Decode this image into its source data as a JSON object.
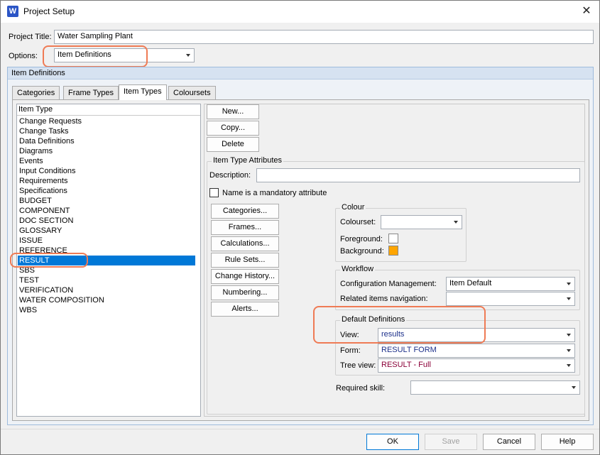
{
  "window": {
    "title": "Project Setup",
    "app_icon_letter": "W"
  },
  "project": {
    "title_label": "Project Title:",
    "title_value": "Water Sampling Plant",
    "options_label": "Options:",
    "options_value": "Item Definitions"
  },
  "section": {
    "header": "Item Definitions"
  },
  "tabs": [
    {
      "label": "Categories",
      "active": false
    },
    {
      "label": "Frame Types",
      "active": false
    },
    {
      "label": "Item Types",
      "active": true
    },
    {
      "label": "Coloursets",
      "active": false
    }
  ],
  "item_list": {
    "header": "Item Type",
    "items": [
      "Change Requests",
      "Change Tasks",
      "Data Definitions",
      "Diagrams",
      "Events",
      "Input Conditions",
      "Requirements",
      "Specifications",
      "BUDGET",
      "COMPONENT",
      "DOC SECTION",
      "GLOSSARY",
      "ISSUE",
      "REFERENCE",
      "RESULT",
      "SBS",
      "TEST",
      "VERIFICATION",
      "WATER COMPOSITION",
      "WBS"
    ],
    "selected": "RESULT"
  },
  "actions": {
    "new": "New...",
    "copy": "Copy...",
    "delete": "Delete"
  },
  "attributes": {
    "group_title": "Item Type Attributes",
    "description_label": "Description:",
    "description_value": "",
    "mandatory_label": "Name is a mandatory attribute",
    "mandatory_checked": false
  },
  "side_buttons": {
    "categories": "Categories...",
    "frames": "Frames...",
    "calculations": "Calculations...",
    "rule_sets": "Rule Sets...",
    "change_history": "Change History...",
    "numbering": "Numbering...",
    "alerts": "Alerts..."
  },
  "colour": {
    "group_title": "Colour",
    "colourset_label": "Colourset:",
    "colourset_value": "",
    "foreground_label": "Foreground:",
    "foreground_color": "#ffffff",
    "background_label": "Background:",
    "background_color": "#ffa500"
  },
  "workflow": {
    "group_title": "Workflow",
    "config_label": "Configuration Management:",
    "config_value": "Item Default",
    "related_label": "Related items navigation:",
    "related_value": ""
  },
  "default_definitions": {
    "group_title": "Default Definitions",
    "view_label": "View:",
    "view_value": "results",
    "form_label": "Form:",
    "form_value": "RESULT FORM",
    "tree_label": "Tree view:",
    "tree_value": "RESULT - Full"
  },
  "required_skill": {
    "label": "Required skill:",
    "value": ""
  },
  "footer": {
    "ok": "OK",
    "save": "Save",
    "cancel": "Cancel",
    "help": "Help"
  },
  "colors": {
    "highlight": "#ef7b55",
    "selection": "#0078d7"
  }
}
